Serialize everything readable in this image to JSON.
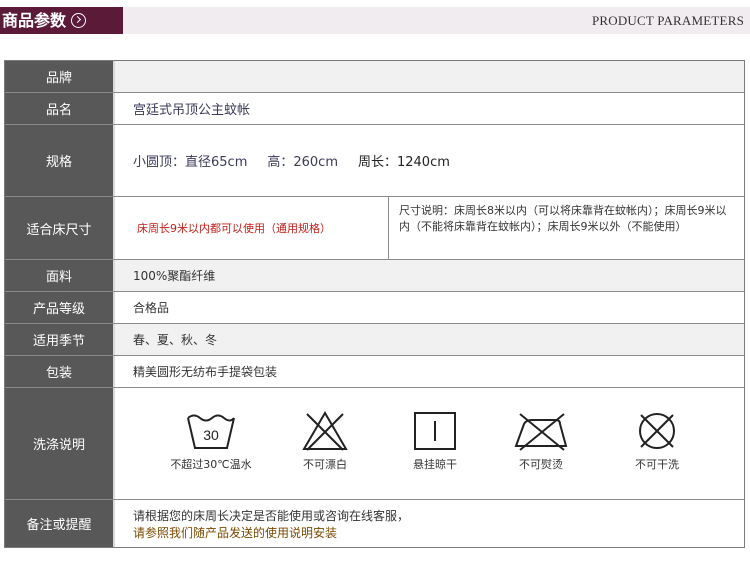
{
  "header": {
    "title": "商品参数",
    "subtitle": "PRODUCT PARAMETERS"
  },
  "rows": {
    "brand": {
      "label": "品牌",
      "value": ""
    },
    "name": {
      "label": "品名",
      "value": "宫廷式吊顶公主蚊帐"
    },
    "spec": {
      "label": "规格",
      "part1": "小圆顶：直径65cm",
      "part2": "高：260cm",
      "part3": "周长：1240cm"
    },
    "bed_size": {
      "label": "适合床尺寸",
      "left": "床周长9米以内都可以使用（通用规格）",
      "right": "尺寸说明：床周长8米以内（可以将床靠背在蚊帐内）；床周长9米以内（不能将床靠背在蚊帐内）；床周长9米以外（不能使用）"
    },
    "fabric": {
      "label": "面料",
      "value": "100%聚酯纤维"
    },
    "grade": {
      "label": "产品等级",
      "value": "合格品"
    },
    "season": {
      "label": "适用季节",
      "value": "春、夏、秋、冬"
    },
    "package": {
      "label": "包装",
      "value": "精美圆形无纺布手提袋包装"
    },
    "wash": {
      "label": "洗涤说明",
      "items": [
        {
          "icon": "wash-30-icon",
          "number": "30",
          "label": "不超过30℃温水"
        },
        {
          "icon": "no-bleach-icon",
          "label": "不可漂白"
        },
        {
          "icon": "hang-dry-icon",
          "label": "悬挂晾干"
        },
        {
          "icon": "no-iron-icon",
          "label": "不可熨烫"
        },
        {
          "icon": "no-dry-clean-icon",
          "label": "不可干洗"
        }
      ]
    },
    "remark": {
      "label": "备注或提醒",
      "line1": "请根据您的床周长决定是否能使用或咨询在线客服，",
      "line2": "请参照我们随产品发送的使用说明安装"
    }
  },
  "colors": {
    "header_bg": "#5a1a38",
    "header_strip": "#f1ecef",
    "label_bg": "#585858",
    "red_text": "#c0201a"
  }
}
